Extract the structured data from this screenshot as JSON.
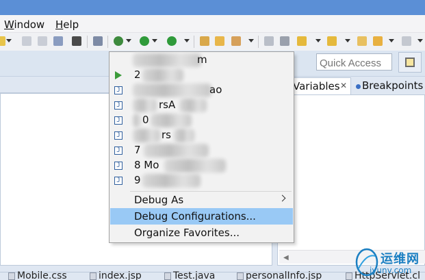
{
  "window": {
    "accent_color": "#5b8fd6"
  },
  "menubar": {
    "items": [
      {
        "label": "Window",
        "mnemonic": "W",
        "rest": "indow"
      },
      {
        "label": "Help",
        "mnemonic": "H",
        "rest": "elp"
      }
    ]
  },
  "toolbar": {
    "icons": [
      "new-icon",
      "save-icon",
      "save-all-icon",
      "print-icon",
      "grid-icon",
      "coverage-icon",
      "debug-icon",
      "run-icon",
      "external-tools-icon",
      "new-package-icon",
      "open-folder-icon",
      "search-icon",
      "edit-icon",
      "history-icon",
      "next-annotation-icon",
      "prev-annotation-icon",
      "last-edit-icon",
      "back-icon",
      "forward-icon"
    ]
  },
  "quick_access": {
    "placeholder": "Quick Access"
  },
  "right_panel": {
    "tabs": [
      {
        "label": "Variables",
        "close": "✕"
      },
      {
        "label": "Breakpoints"
      }
    ]
  },
  "dropdown": {
    "history": [
      {
        "visible_text": "m"
      },
      {
        "visible_text": "2"
      },
      {
        "visible_text": "ao"
      },
      {
        "visible_text": "rsA"
      },
      {
        "visible_text": "0"
      },
      {
        "visible_text": "rs"
      },
      {
        "visible_text": "7"
      },
      {
        "visible_text": "8 Mo"
      },
      {
        "visible_text": "9"
      }
    ],
    "actions": [
      {
        "label": "Debug As",
        "has_submenu": true
      },
      {
        "label": "Debug Configurations...",
        "highlighted": true
      },
      {
        "label": "Organize Favorites..."
      }
    ],
    "highlight_color": "#99c9f5"
  },
  "bottom_tabs": [
    {
      "label": "Mobile.css"
    },
    {
      "label": "index.jsp"
    },
    {
      "label": "Test.java"
    },
    {
      "label": "personalInfo.jsp"
    },
    {
      "label": "HttpServlet.cl"
    }
  ],
  "watermark": {
    "title": "运维网",
    "url": "iyunv.com"
  }
}
